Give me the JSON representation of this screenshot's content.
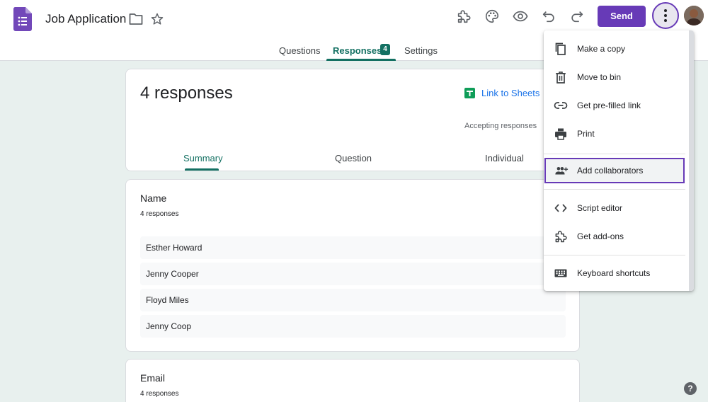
{
  "header": {
    "title": "Job Application",
    "send_label": "Send",
    "icons": [
      "forms-logo",
      "folder-icon",
      "star-icon",
      "addons-icon",
      "palette-icon",
      "preview-icon",
      "undo-icon",
      "redo-icon",
      "more-vert-icon",
      "avatar"
    ]
  },
  "tabs": {
    "questions": "Questions",
    "responses": "Responses",
    "responses_badge": "4",
    "settings": "Settings"
  },
  "summary_card": {
    "count_label": "4 responses",
    "sheets_link": "Link to Sheets",
    "accepting_label": "Accepting responses",
    "subtabs": [
      "Summary",
      "Question",
      "Individual"
    ]
  },
  "name_card": {
    "title": "Name",
    "subtitle": "4 responses",
    "responses": [
      "Esther Howard",
      "Jenny Cooper",
      "Floyd Miles",
      "Jenny Coop"
    ]
  },
  "email_card": {
    "title": "Email",
    "subtitle": "4 responses"
  },
  "menu": {
    "items": [
      {
        "label": "Make a copy",
        "icon": "copy-icon"
      },
      {
        "label": "Move to bin",
        "icon": "trash-icon"
      },
      {
        "label": "Get pre-filled link",
        "icon": "link-icon"
      },
      {
        "label": "Print",
        "icon": "print-icon"
      },
      {
        "label": "Add collaborators",
        "icon": "add-people-icon"
      },
      {
        "label": "Script editor",
        "icon": "code-icon"
      },
      {
        "label": "Get add-ons",
        "icon": "puzzle-icon"
      },
      {
        "label": "Keyboard shortcuts",
        "icon": "keyboard-icon"
      }
    ]
  },
  "colors": {
    "brand": "#673ab7",
    "accent": "#137062",
    "link": "#1a73e8",
    "background": "#e8f0ee"
  }
}
